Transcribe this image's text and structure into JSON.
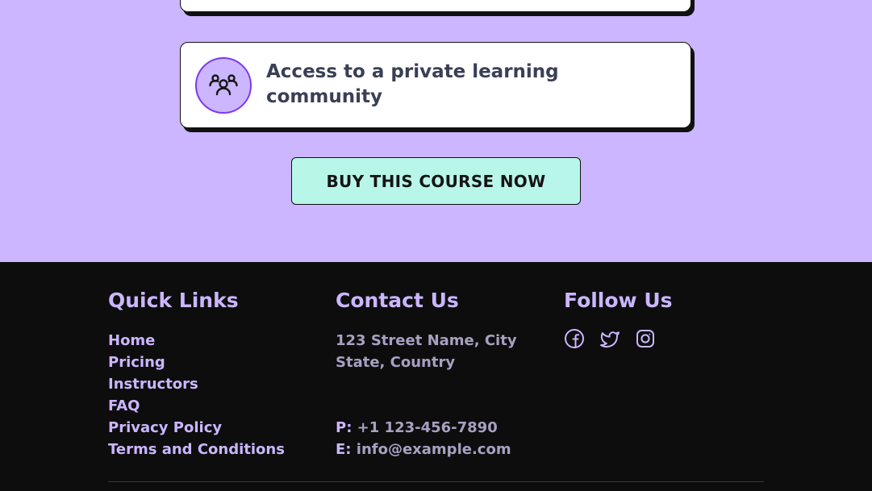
{
  "feature": {
    "text": "Access to a private learning community",
    "icon": "community-icon"
  },
  "cta": {
    "label": "BUY THIS COURSE NOW"
  },
  "footer": {
    "quick_links": {
      "title": "Quick Links",
      "items": [
        "Home",
        "Pricing",
        "Instructors",
        "FAQ",
        "Privacy Policy",
        "Terms and Conditions"
      ]
    },
    "contact": {
      "title": "Contact Us",
      "address_line1": "123 Street Name, City",
      "address_line2": "State, Country",
      "phone_label": "P:",
      "phone": "+1 123-456-7890",
      "email_label": "E:",
      "email": "info@example.com"
    },
    "follow": {
      "title": "Follow Us",
      "icons": [
        "facebook-icon",
        "twitter-icon",
        "instagram-icon"
      ]
    }
  },
  "colors": {
    "hero_bg": "#cbb6ff",
    "cta_bg": "#b9f6ea",
    "footer_bg": "#0d0d0d",
    "accent": "#7c3aed"
  }
}
